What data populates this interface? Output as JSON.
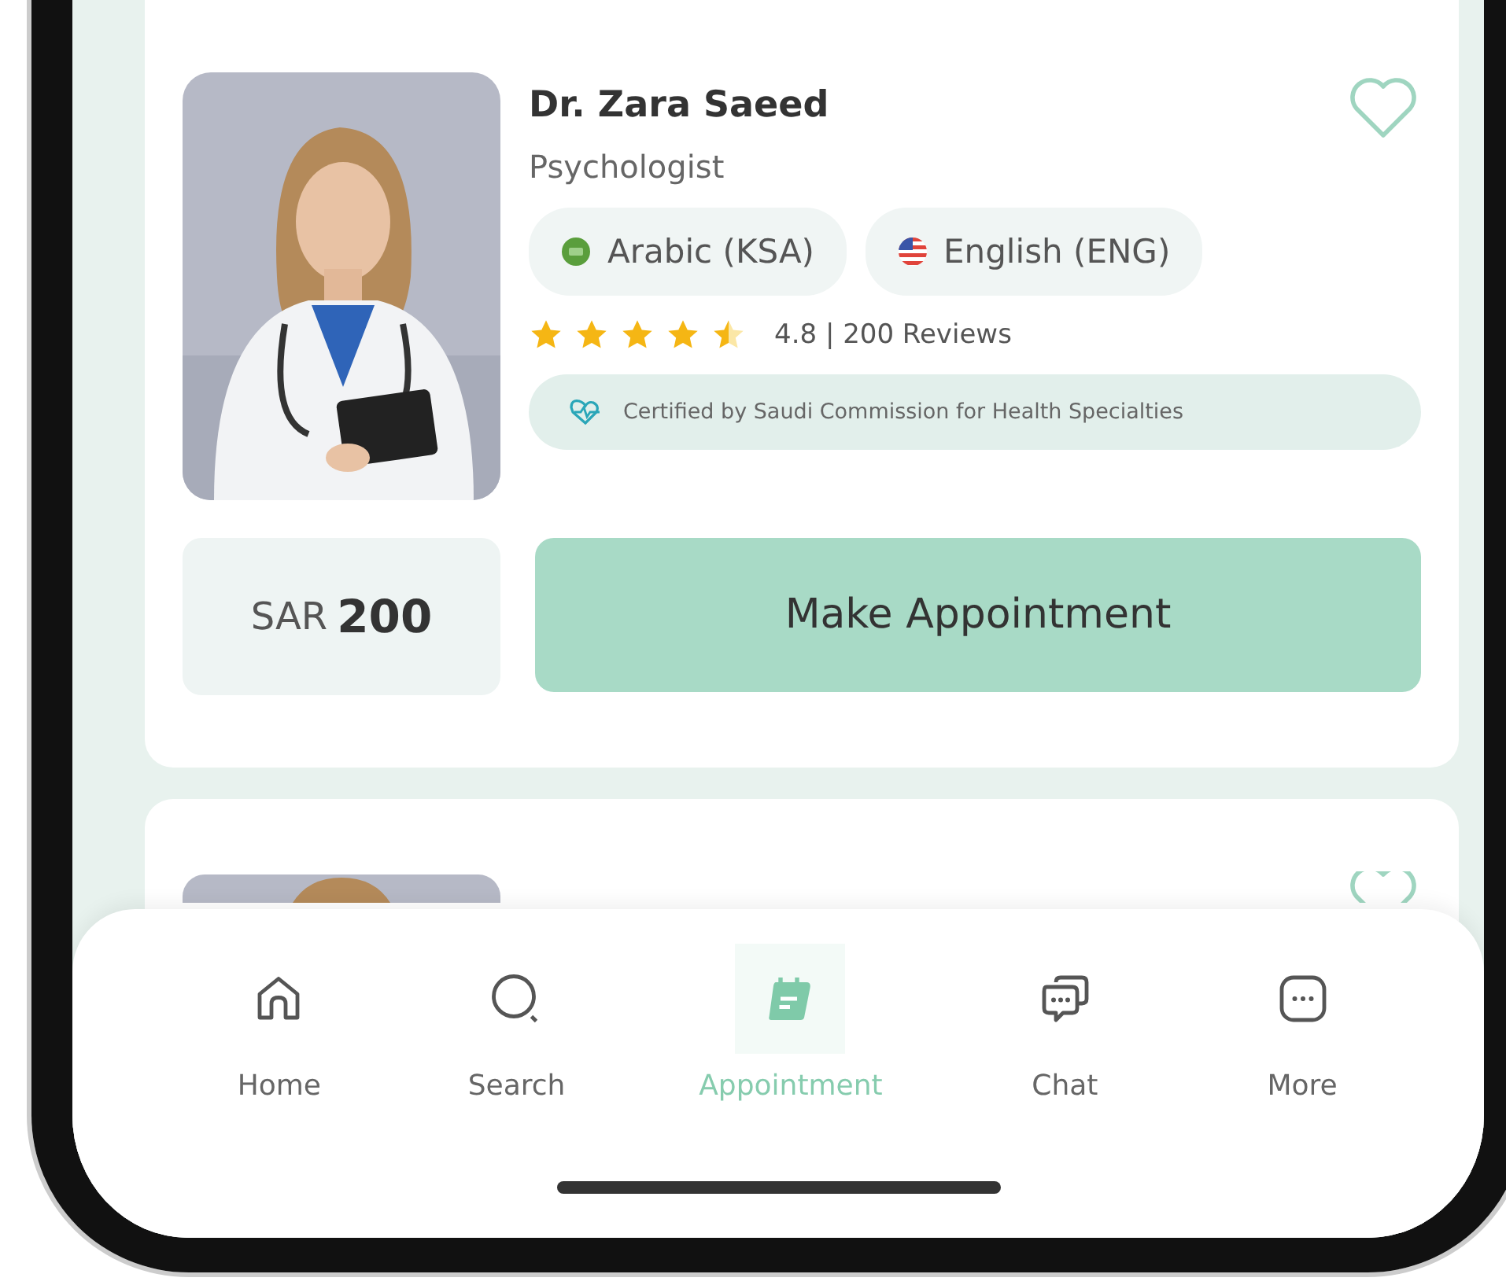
{
  "doctors": [
    {
      "kind": "full",
      "name": "Dr. Zara Saeed",
      "specialty": "Psychologist",
      "favorite": false,
      "languages": [
        "Arabic (KSA)",
        "English (ENG)"
      ],
      "stars": 4.5,
      "rating": "4.8 | 200 Reviews",
      "certification": "Certified by Saudi Commission for Health Specialties",
      "currency": "SAR",
      "price": "200",
      "action": "Make Appointment"
    },
    {
      "kind": "partial",
      "favorite": false
    }
  ],
  "nav": [
    {
      "label": "Home",
      "kind": "home",
      "selected": false
    },
    {
      "label": "Search",
      "kind": "search",
      "selected": false
    },
    {
      "label": "Appointment",
      "kind": "calendar",
      "selected": true
    },
    {
      "label": "Chat",
      "kind": "chat",
      "selected": false
    },
    {
      "label": "More",
      "kind": "more",
      "selected": false
    }
  ]
}
